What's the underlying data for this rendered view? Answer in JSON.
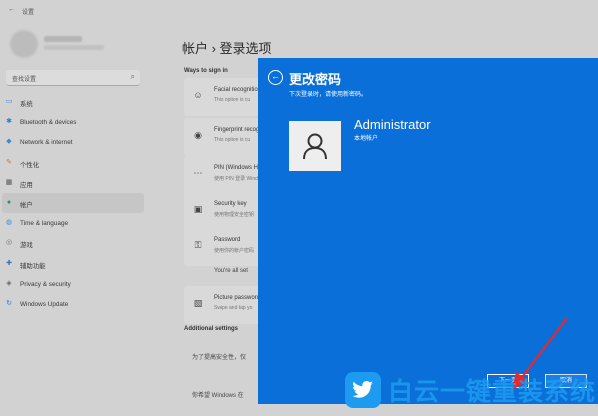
{
  "window": {
    "title": "设置",
    "back_glyph": "←"
  },
  "search": {
    "placeholder": "查找设置",
    "icon": "search-icon",
    "icon_glyph": "⌕"
  },
  "sidebar": {
    "items": [
      {
        "label": "系统",
        "icon": "system-icon",
        "glyph": "▭",
        "color": "#4a7fc9"
      },
      {
        "label": "Bluetooth & devices",
        "icon": "bluetooth-icon",
        "glyph": "✱",
        "color": "#2b79d6"
      },
      {
        "label": "Network & internet",
        "icon": "network-icon",
        "glyph": "◆",
        "color": "#3d8ad6"
      },
      {
        "label": "个性化",
        "icon": "brush-icon",
        "glyph": "✎",
        "color": "#c4763b"
      },
      {
        "label": "应用",
        "icon": "apps-icon",
        "glyph": "▦",
        "color": "#555555"
      },
      {
        "label": "帐户",
        "icon": "account-icon",
        "glyph": "●",
        "color": "#2f8c73",
        "active": true
      },
      {
        "label": "Time & language",
        "icon": "globe-icon",
        "glyph": "◍",
        "color": "#3d8ad6"
      },
      {
        "label": "游戏",
        "icon": "gaming-icon",
        "glyph": "◎",
        "color": "#777777"
      },
      {
        "label": "辅助功能",
        "icon": "accessibility-icon",
        "glyph": "✚",
        "color": "#3d6fb5"
      },
      {
        "label": "Privacy & security",
        "icon": "shield-icon",
        "glyph": "◈",
        "color": "#666666"
      },
      {
        "label": "Windows Update",
        "icon": "update-icon",
        "glyph": "↻",
        "color": "#2b79d6"
      }
    ]
  },
  "main": {
    "breadcrumb": "帐户  ›  登录选项",
    "ways_label": "Ways to sign in",
    "options": [
      {
        "title": "Facial recognition",
        "desc": "This option is cu",
        "icon": "face-icon",
        "glyph": "☺"
      },
      {
        "title": "Fingerprint recognition",
        "desc": "This option is cu",
        "icon": "fingerprint-icon",
        "glyph": "◉"
      },
      {
        "title": "PIN (Windows Hello)",
        "desc": "使用 PIN 登录 Wind",
        "icon": "pin-icon",
        "glyph": "⋯"
      },
      {
        "title": "Security key",
        "desc": "使用物理安全密钥",
        "icon": "key-icon",
        "glyph": "▣"
      },
      {
        "title": "Password",
        "desc": "使用你的帐户密码",
        "icon": "password-icon",
        "glyph": "⚿"
      }
    ],
    "all_set": "You're all set",
    "picture_password": {
      "title": "Picture password",
      "desc": "Swipe and tap yo",
      "icon": "picture-icon",
      "glyph": "▧"
    },
    "additional_label": "Additional settings",
    "security_text": "为了提高安全性，仅",
    "away_text": "你希望 Windows 在"
  },
  "dialog": {
    "title": "更改密码",
    "subtitle": "下次登录时，请使用新密码。",
    "back_icon": "back-arrow-icon",
    "back_glyph": "←",
    "user_name": "Administrator",
    "user_type": "本地帐户",
    "next_label": "下一页",
    "cancel_label": "取消",
    "color": "#0a6fd8"
  },
  "watermark": {
    "text": "白云一键重装系统",
    "icon": "bird-logo-icon"
  }
}
